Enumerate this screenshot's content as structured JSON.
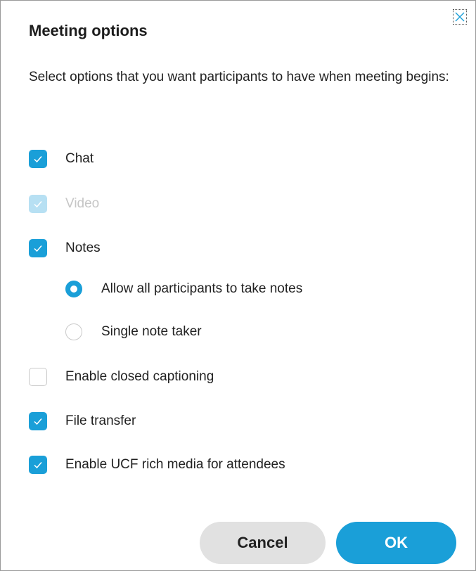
{
  "dialog": {
    "title": "Meeting options",
    "description": "Select options that you want participants to have when meeting begins:",
    "close_icon": "close-icon"
  },
  "options": {
    "chat": {
      "label": "Chat",
      "checked": true,
      "disabled": false
    },
    "video": {
      "label": "Video",
      "checked": true,
      "disabled": true
    },
    "notes": {
      "label": "Notes",
      "checked": true,
      "disabled": false
    },
    "notes_mode": {
      "all": {
        "label": "Allow all participants to take notes",
        "selected": true
      },
      "single": {
        "label": "Single note taker",
        "selected": false
      }
    },
    "closed_captioning": {
      "label": "Enable closed captioning",
      "checked": false
    },
    "file_transfer": {
      "label": "File transfer",
      "checked": true
    },
    "ucf_rich_media": {
      "label": "Enable UCF rich media for attendees",
      "checked": true
    }
  },
  "buttons": {
    "cancel": "Cancel",
    "ok": "OK"
  },
  "colors": {
    "accent": "#1a9fd8",
    "accent_disabled": "#b7e0f3",
    "cancel_bg": "#e1e1e1"
  }
}
